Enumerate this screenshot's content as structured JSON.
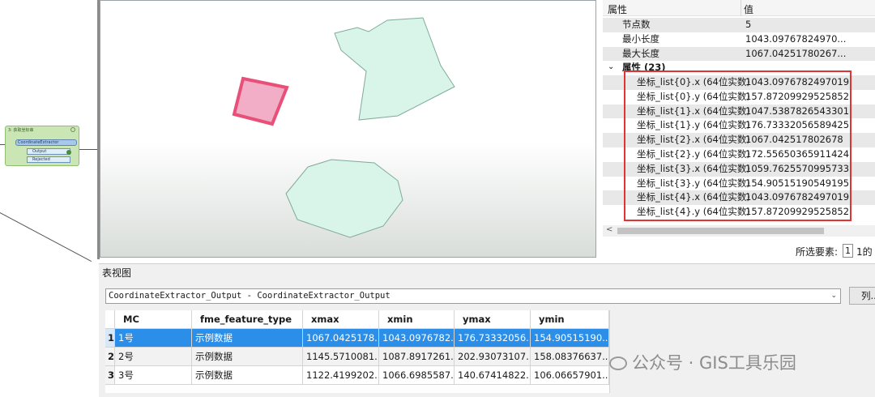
{
  "canvas": {
    "transformer": {
      "title": "3: 获取坐标串",
      "name": "CoordinateExtractor",
      "ports": [
        "Output",
        "Rejected"
      ]
    }
  },
  "map": {
    "polygon_colors": {
      "selected_fill": "#f2aec7",
      "selected_stroke": "#e8507a",
      "fill": "#d9f5ea",
      "stroke": "#7faa98"
    }
  },
  "properties": {
    "header": {
      "attribute": "属性",
      "value": "值"
    },
    "top_rows": [
      {
        "key": "节点数",
        "value": "5"
      },
      {
        "key": "最小长度",
        "value": "1043.09767824970..."
      },
      {
        "key": "最大长度",
        "value": "1067.04251780267..."
      }
    ],
    "group_label": "属性 (23)",
    "attribute_rows": [
      {
        "key": "坐标_list{0}.x (64位实数)",
        "value": "1043.0976782497019"
      },
      {
        "key": "坐标_list{0}.y (64位实数)",
        "value": "157.87209929525852"
      },
      {
        "key": "坐标_list{1}.x (64位实数)",
        "value": "1047.5387826543301"
      },
      {
        "key": "坐标_list{1}.y (64位实数)",
        "value": "176.73332056589425"
      },
      {
        "key": "坐标_list{2}.x (64位实数)",
        "value": "1067.042517802678"
      },
      {
        "key": "坐标_list{2}.y (64位实数)",
        "value": "172.55650365911424"
      },
      {
        "key": "坐标_list{3}.x (64位实数)",
        "value": "1059.7625570995733"
      },
      {
        "key": "坐标_list{3}.y (64位实数)",
        "value": "154.90515190549195"
      },
      {
        "key": "坐标_list{4}.x (64位实数)",
        "value": "1043.0976782497019"
      },
      {
        "key": "坐标_list{4}.y (64位实数)",
        "value": "157.87209929525852"
      }
    ],
    "highlight_color": "#e03434",
    "selected_label": "所选要素:",
    "selected_value": "1",
    "selected_suffix": "1的"
  },
  "table_view": {
    "title": "表视图",
    "dataset": "CoordinateExtractor_Output - CoordinateExtractor_Output",
    "columns_button": "列...",
    "columns": [
      "MC",
      "fme_feature_type",
      "xmax",
      "xmin",
      "ymax",
      "ymin"
    ],
    "rows": [
      {
        "num": "1",
        "cells": [
          "1号",
          "示例数据",
          "1067.0425178...",
          "1043.0976782...",
          "176.73332056...",
          "154.90515190..."
        ]
      },
      {
        "num": "2",
        "cells": [
          "2号",
          "示例数据",
          "1145.5710081...",
          "1087.8917261...",
          "202.93073107...",
          "158.08376637..."
        ]
      },
      {
        "num": "3",
        "cells": [
          "3号",
          "示例数据",
          "1122.4199202...",
          "1066.6985587...",
          "140.67414822...",
          "106.06657901..."
        ]
      }
    ],
    "selected_color": "#2b8ee8"
  },
  "watermark": "公众号 · GIS工具乐园"
}
